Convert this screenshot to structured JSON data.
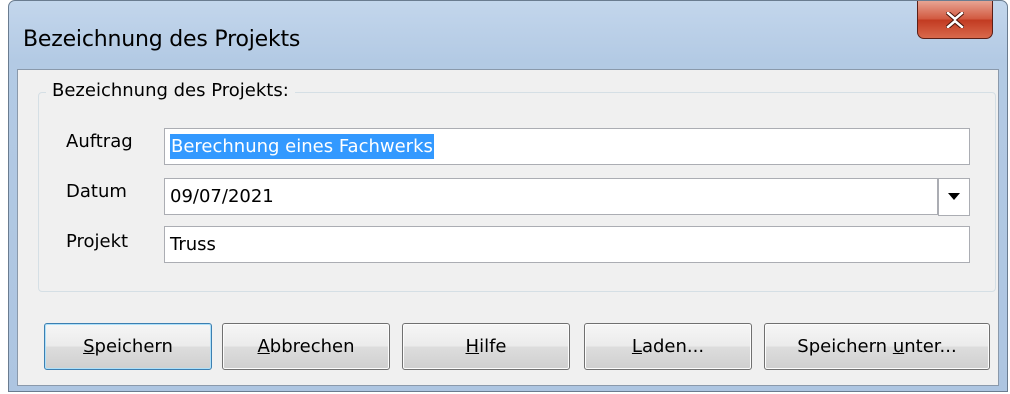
{
  "window": {
    "title": "Bezeichnung des Projekts",
    "close_icon": "close-icon"
  },
  "group": {
    "legend": "Bezeichnung des Projekts:"
  },
  "fields": {
    "auftrag": {
      "label": "Auftrag",
      "value": "Berechnung eines Fachwerks"
    },
    "datum": {
      "label": "Datum",
      "value": "09/07/2021"
    },
    "projekt": {
      "label": "Projekt",
      "value": "Truss"
    }
  },
  "buttons": {
    "speichern": {
      "accel": "S",
      "rest": "peichern"
    },
    "abbrechen": {
      "accel": "A",
      "rest": "bbrechen"
    },
    "hilfe": {
      "accel": "H",
      "rest": "ilfe"
    },
    "laden": {
      "accel": "L",
      "rest": "aden..."
    },
    "speichern_unter": {
      "pre": "Speichern ",
      "accel": "u",
      "rest": "nter..."
    }
  }
}
